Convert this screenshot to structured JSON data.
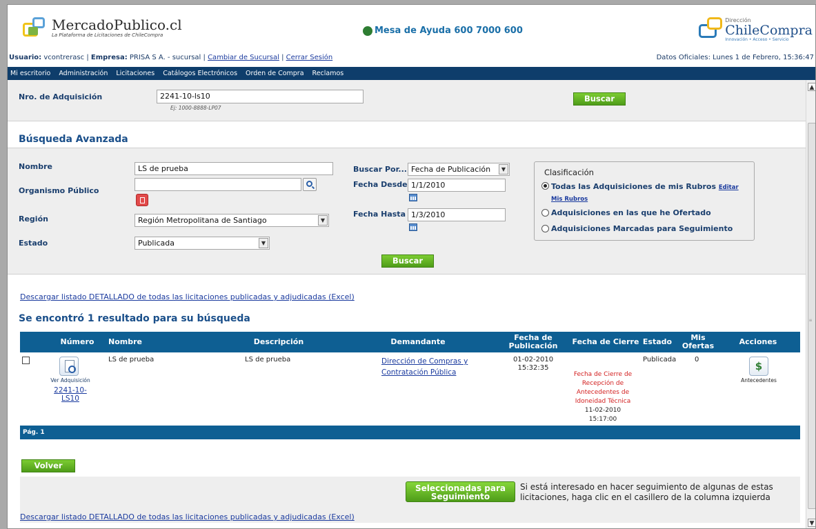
{
  "header": {
    "mp_title": "MercadoPublico.cl",
    "mp_subtitle": "La Plataforma de Licitaciones de ChileCompra",
    "help_text": "Mesa de Ayuda 600 7000 600",
    "cc_dir": "Dirección",
    "cc_title": "ChileCompra",
    "cc_subtitle": "Innovación • Acceso • Servicio",
    "user_label": "Usuario:",
    "user_value": "vcontrerasc",
    "company_label": "Empresa:",
    "company_value": "PRISA S A. - sucursal",
    "change_branch": "Cambiar de Sucursal",
    "logout": "Cerrar Sesión",
    "official_data": "Datos Oficiales: Lunes 1 de Febrero, 15:36:47"
  },
  "nav": {
    "items": [
      "Mi escritorio",
      "Administración",
      "Licitaciones",
      "Catálogos Electrónicos",
      "Orden de Compra",
      "Reclamos"
    ]
  },
  "nro": {
    "label": "Nro. de Adquisición",
    "value": "2241-10-ls10",
    "hint": "Ej: 1000-8888-LP07",
    "search_button": "Buscar"
  },
  "advanced": {
    "title": "Búsqueda Avanzada",
    "name_label": "Nombre",
    "name_value": "LS de prueba",
    "org_label": "Organismo Público",
    "org_value": "",
    "region_label": "Región",
    "region_value": "Región Metropolitana de Santiago",
    "state_label": "Estado",
    "state_value": "Publicada",
    "search_by_label": "Buscar Por...",
    "search_by_value": "Fecha de Publicación",
    "date_from_label": "Fecha Desde",
    "date_from_value": "1/1/2010",
    "date_to_label": "Fecha Hasta",
    "date_to_value": "1/3/2010",
    "search_button": "Buscar",
    "classification": {
      "title": "Clasificación",
      "option1": "Todas las Adquisiciones de mis Rubros",
      "edit_link": "Editar Mis Rubros",
      "option2": "Adquisiciones en las que he Ofertado",
      "option3": "Adquisiciones Marcadas para Seguimiento",
      "selected": 1
    }
  },
  "download_link": "Descargar listado DETALLADO de todas las licitaciones publicadas y adjudicadas (Excel)",
  "results": {
    "title": "Se encontró 1 resultado para su búsqueda",
    "columns": {
      "numero": "Número",
      "nombre": "Nombre",
      "descripcion": "Descripción",
      "demandante": "Demandante",
      "fecha_pub": "Fecha de Publicación",
      "fecha_cierre": "Fecha de Cierre",
      "estado": "Estado",
      "mis_ofertas": "Mis Ofertas",
      "acciones": "Acciones"
    },
    "row": {
      "view_label": "Ver Adquisición",
      "numero": "2241-10-LS10",
      "nombre": "LS de prueba",
      "descripcion": "LS de prueba",
      "demandante": "Dirección de Compras y Contratación Pública",
      "fecha_pub_date": "01-02-2010",
      "fecha_pub_time": "15:32:35",
      "cierre_note": "Fecha de Cierre de Recepción de Antecedentes de Idoneidad Técnica",
      "cierre_date": "11-02-2010",
      "cierre_time": "15:17:00",
      "estado": "Publicada",
      "mis_ofertas": "0",
      "action_label": "Antecedentes"
    },
    "pagination": "Pág. 1"
  },
  "back_button": "Volver",
  "follow_button": "Seleccionadas para Seguimiento",
  "follow_note": "Si está interesado en hacer seguimiento de algunas de estas licitaciones, haga clic en el casillero de la columna izquierda",
  "colors": {
    "nav_bg": "#0e3d6b",
    "table_header": "#0e5f93",
    "button_green": "#5aa822",
    "link": "#1a3a9e"
  }
}
